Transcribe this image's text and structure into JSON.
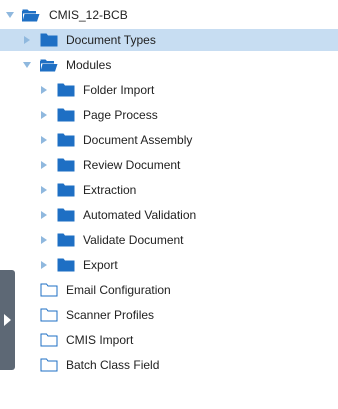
{
  "tree": {
    "root": {
      "label": "CMIS_12-BCB"
    },
    "document_types": {
      "label": "Document Types"
    },
    "modules": {
      "label": "Modules",
      "children": [
        {
          "label": "Folder Import"
        },
        {
          "label": "Page Process"
        },
        {
          "label": "Document Assembly"
        },
        {
          "label": "Review Document"
        },
        {
          "label": "Extraction"
        },
        {
          "label": "Automated Validation"
        },
        {
          "label": "Validate Document"
        },
        {
          "label": "Export"
        }
      ]
    },
    "email_configuration": {
      "label": "Email Configuration"
    },
    "scanner_profiles": {
      "label": "Scanner Profiles"
    },
    "cmis_import": {
      "label": "CMIS Import"
    },
    "batch_class_field": {
      "label": "Batch Class Field"
    }
  },
  "colors": {
    "folder_blue": "#1e6fc4",
    "arrow_blue": "#8fb8de",
    "selection": "#c7ddf2",
    "side_tab": "#5d6875"
  },
  "icons": {
    "expanded": "caret-down-icon",
    "collapsed": "caret-right-icon",
    "folder_closed": "folder-filled-icon",
    "folder_open": "folder-open-icon",
    "folder_outline": "folder-outline-icon"
  }
}
